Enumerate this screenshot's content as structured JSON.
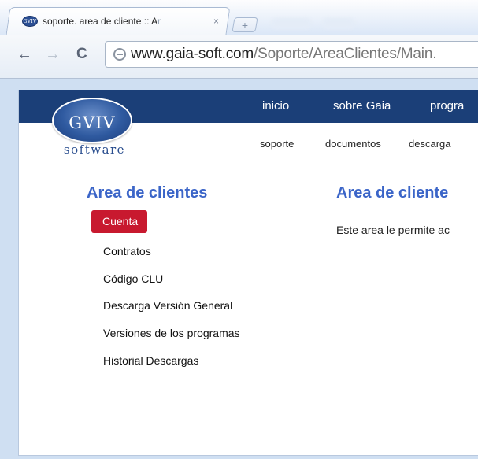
{
  "browser": {
    "tab": {
      "title_main": "soporte. area de cliente :: A",
      "title_fade": "r",
      "close": "×",
      "favicon_text": "GVIV"
    },
    "new_tab": "+",
    "nav": {
      "back": "←",
      "forward": "→",
      "reload": "C"
    },
    "url": {
      "host": "www.gaia-soft.com",
      "path": "/Soporte/AreaClientes/Main."
    }
  },
  "site": {
    "logo": {
      "text": "GVIV",
      "subtitle": "software"
    },
    "main_nav": [
      "inicio",
      "sobre Gaia",
      "progra"
    ],
    "sub_nav": [
      "soporte",
      "documentos",
      "descarga"
    ],
    "sidebar": {
      "title": "Area de clientes",
      "items": [
        "Cuenta",
        "Contratos",
        "Código CLU",
        "Descarga Versión General",
        "Versiones de los programas",
        "Historial Descargas"
      ],
      "active_index": 0
    },
    "content": {
      "title": "Area de cliente",
      "text": "Este area le permite ac"
    }
  },
  "colors": {
    "nav_bar": "#1b3f78",
    "heading": "#3b65c8",
    "active_item": "#c8192f",
    "chrome_frame": "#cfdff2"
  }
}
